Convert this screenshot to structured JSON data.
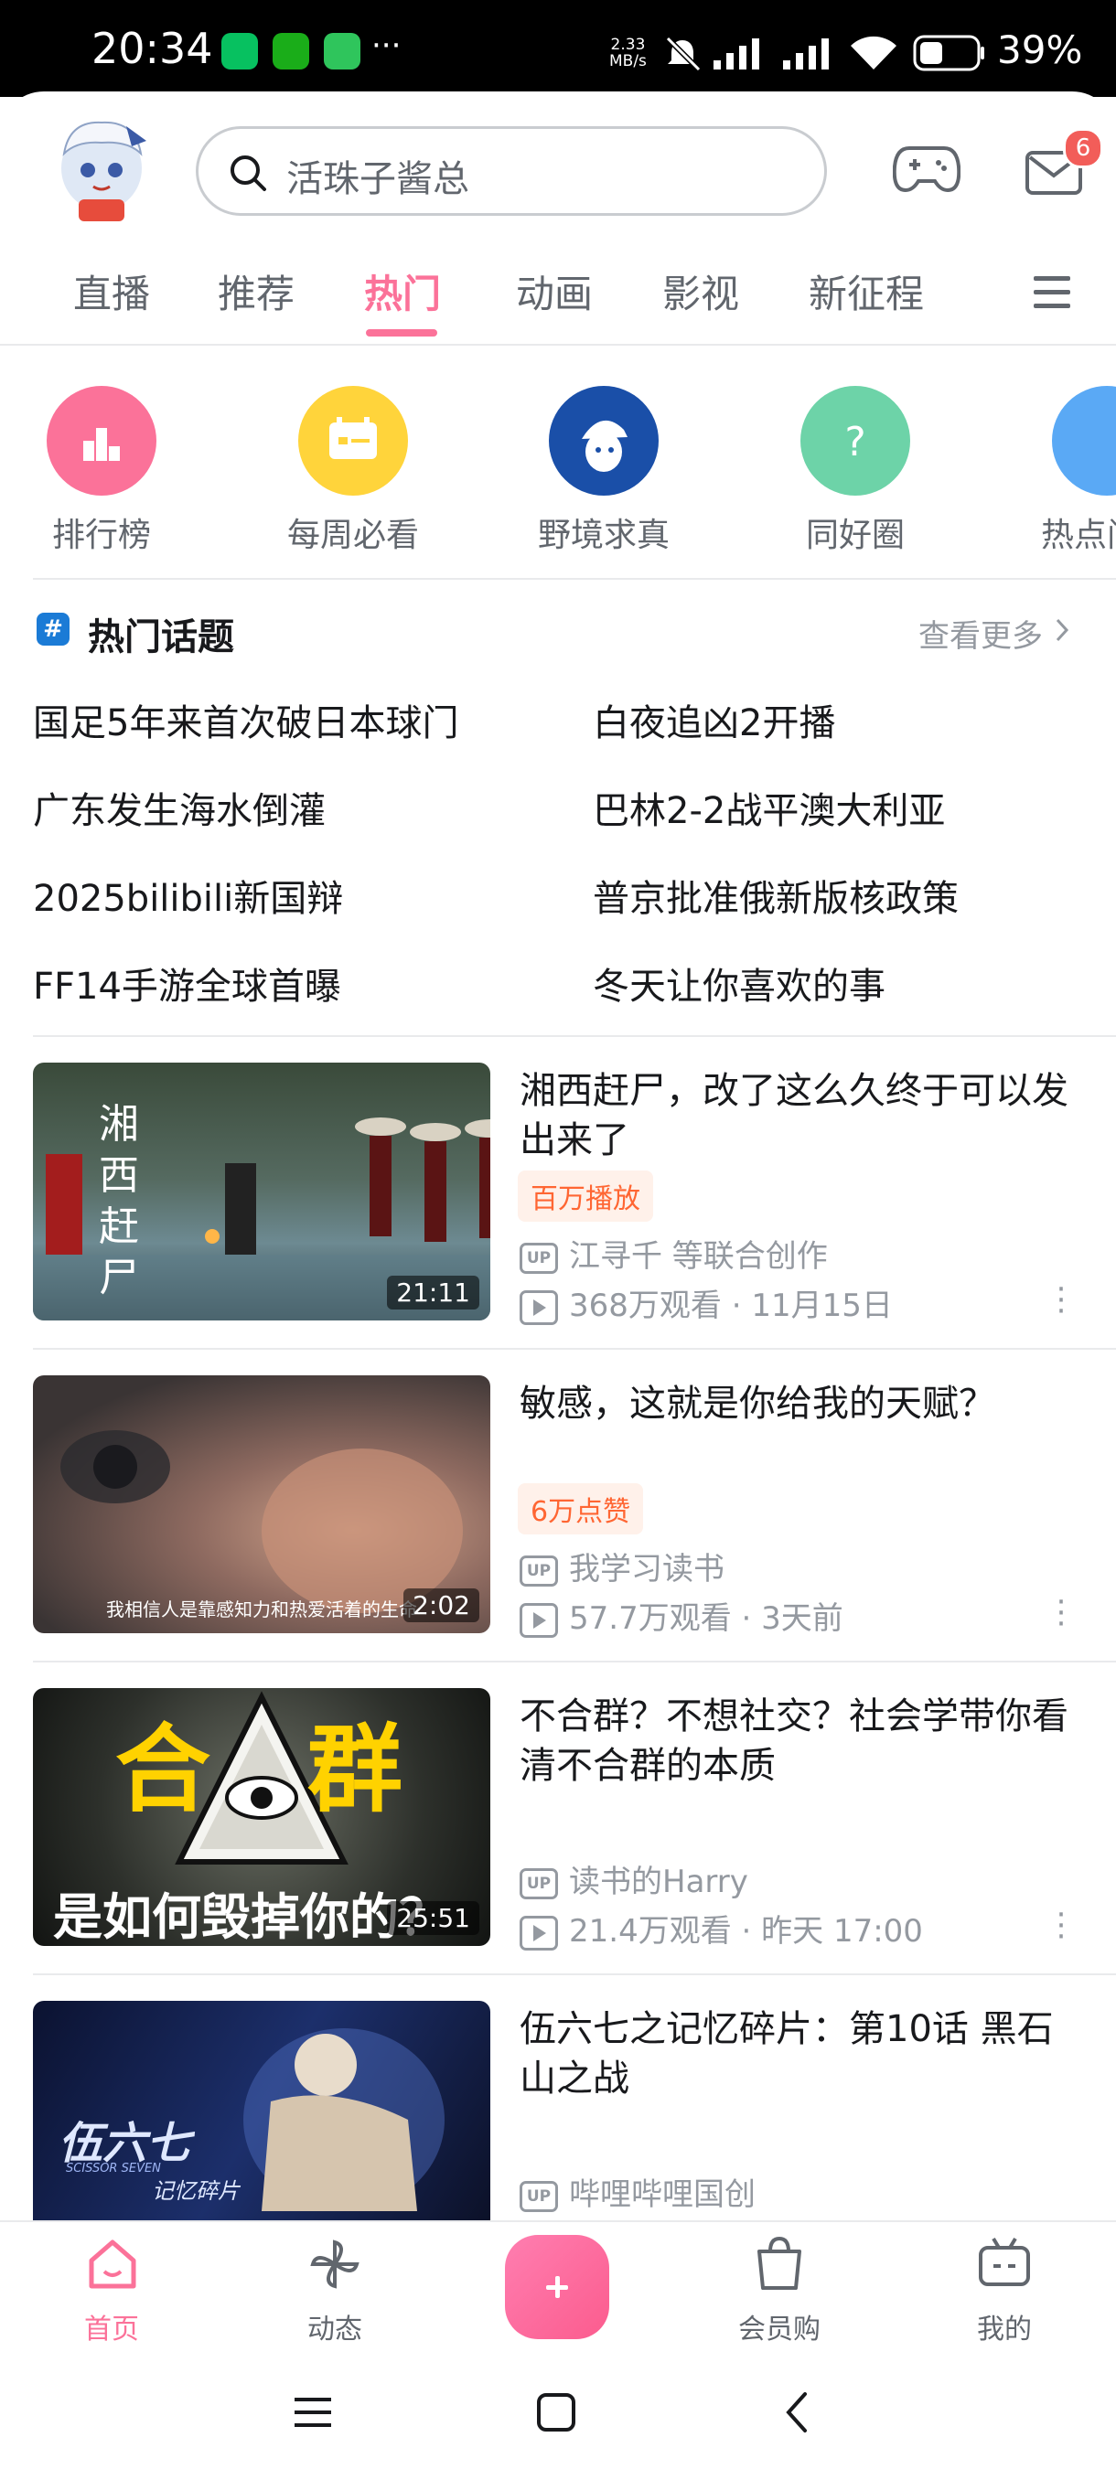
{
  "status_bar": {
    "time": "20:34",
    "more": "···",
    "net_speed_value": "2.33",
    "net_speed_unit": "MB/s",
    "battery": "39%"
  },
  "header": {
    "search_placeholder": "活珠子酱总",
    "mail_badge": "6"
  },
  "tabs": [
    {
      "label": "直播"
    },
    {
      "label": "推荐"
    },
    {
      "label": "热门"
    },
    {
      "label": "动画"
    },
    {
      "label": "影视"
    },
    {
      "label": "新征程"
    }
  ],
  "shortcuts": [
    {
      "label": "排行榜",
      "color": "#fb7299"
    },
    {
      "label": "每周必看",
      "color": "#ffd43b"
    },
    {
      "label": "野境求真",
      "color": "#1a4fa8"
    },
    {
      "label": "同好圈",
      "color": "#6dd3a8"
    },
    {
      "label": "热点问",
      "color": "#5aa9f5"
    }
  ],
  "hot_topics": {
    "title": "热门话题",
    "more_label": "查看更多",
    "items": [
      "国足5年来首次破日本球门",
      "白夜追凶2开播",
      "广东发生海水倒灌",
      "巴林2-2战平澳大利亚",
      "2025bilibili新国辩",
      "普京批准俄新版核政策",
      "FF14手游全球首曝",
      "冬天让你喜欢的事"
    ]
  },
  "videos": [
    {
      "title": "湘西赶尸，改了这么久终于可以发出来了",
      "badge": "百万播放",
      "up_label": "UP",
      "author": "江寻千 等联合创作",
      "views": "368万观看",
      "date": "11月15日",
      "duration": "21:11",
      "thumb_text": "湘西赶尸"
    },
    {
      "title": "敏感，这就是你给我的天赋？",
      "badge": "6万点赞",
      "up_label": "UP",
      "author": "我学习读书",
      "views": "57.7万观看",
      "date": "3天前",
      "duration": "2:02",
      "thumb_text": "我相信人是靠感知力和热爱活着的生命"
    },
    {
      "title": "不合群？不想社交？社会学带你看清不合群的本质",
      "badge": "",
      "up_label": "UP",
      "author": "读书的Harry",
      "views": "21.4万观看",
      "date": "昨天 17:00",
      "duration": "25:51",
      "thumb_text_1": "合",
      "thumb_text_2": "群",
      "thumb_text_3": "是如何毁掉你的？"
    },
    {
      "title": "伍六七之记忆碎片：第10话 黑石山之战",
      "badge": "",
      "up_label": "UP",
      "author": "哔哩哔哩国创",
      "views": "",
      "date": "",
      "duration": "",
      "thumb_text_1": "伍六七",
      "thumb_text_2": "SCISSOR SEVEN",
      "thumb_text_3": "记忆碎片"
    }
  ],
  "bottom_nav": [
    {
      "label": "首页"
    },
    {
      "label": "动态"
    },
    {
      "label": "会员购"
    },
    {
      "label": "我的"
    }
  ],
  "colors": {
    "accent": "#fb7299",
    "badge_text": "#ff6633",
    "meta_text": "#9499a0"
  }
}
